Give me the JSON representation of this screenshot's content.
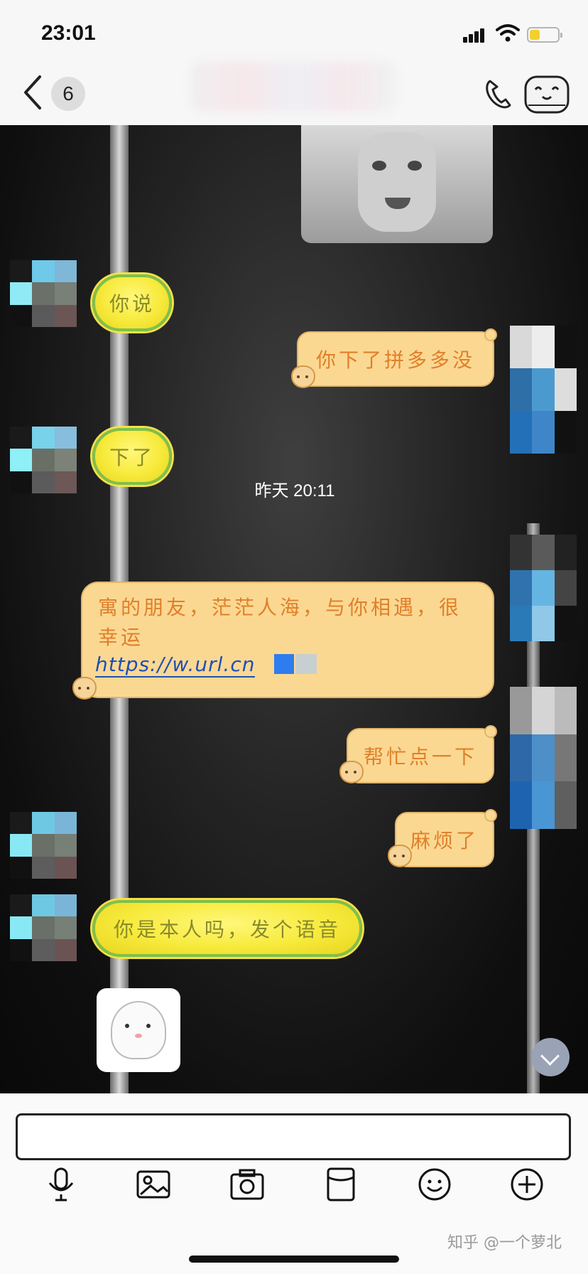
{
  "status_bar": {
    "time": "23:01"
  },
  "nav": {
    "unread_count": "6"
  },
  "chat": {
    "messages": [
      {
        "side": "left",
        "type": "text",
        "text": "你说"
      },
      {
        "side": "right",
        "type": "text",
        "text": "你下了拼多多没"
      },
      {
        "side": "left",
        "type": "text",
        "text": "下了"
      },
      {
        "side": "right",
        "type": "text",
        "text": "帮忙点一下"
      },
      {
        "side": "right",
        "type": "text",
        "text": "麻烦了"
      },
      {
        "side": "left",
        "type": "text",
        "text": "你是本人吗，发个语音"
      }
    ],
    "timestamp": "昨天 20:11",
    "share_message": {
      "text": "寓的朋友，茫茫人海，与你相遇，很幸运",
      "link": "https://w.url.cn"
    }
  },
  "toolbar": {
    "icons": [
      "microphone-icon",
      "image-icon",
      "camera-icon",
      "red-packet-icon",
      "emoji-icon",
      "plus-icon"
    ]
  },
  "watermark": "知乎 @一个萝北"
}
